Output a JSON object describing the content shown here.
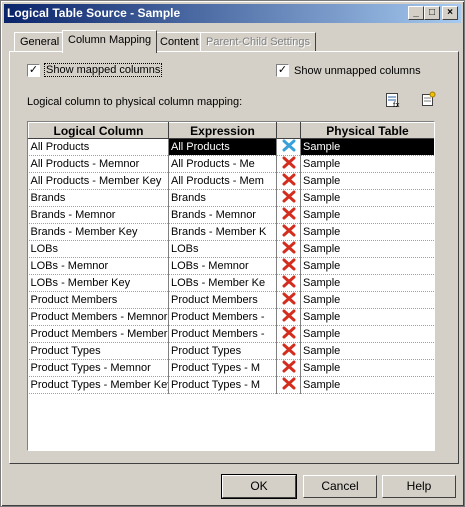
{
  "window": {
    "title": "Logical Table Source - Sample"
  },
  "titlebar_buttons": {
    "minimize": "_",
    "maximize": "□",
    "close": "×"
  },
  "tabs": [
    {
      "label": "General"
    },
    {
      "label": "Column Mapping"
    },
    {
      "label": "Content"
    },
    {
      "label": "Parent-Child Settings"
    }
  ],
  "options": {
    "show_mapped_label": "Show mapped columns",
    "show_mapped_checked": true,
    "show_unmapped_label": "Show unmapped columns",
    "show_unmapped_checked": true,
    "mapping_caption": "Logical column to physical column mapping:"
  },
  "grid": {
    "headers": {
      "logical": "Logical Column",
      "expression": "Expression",
      "physical": "Physical Table"
    },
    "rows": [
      {
        "logical": "All Products",
        "expression": "All Products",
        "physical": "Sample",
        "selected": true
      },
      {
        "logical": "All Products -  Memnor",
        "expression": "All Products  -  Me",
        "physical": "Sample"
      },
      {
        "logical": "All Products - Member Key",
        "expression": "All Products  - Mem",
        "physical": "Sample"
      },
      {
        "logical": "Brands",
        "expression": "Brands",
        "physical": "Sample"
      },
      {
        "logical": "Brands -  Memnor",
        "expression": "Brands -  Memnor",
        "physical": "Sample"
      },
      {
        "logical": "Brands - Member Key",
        "expression": "Brands - Member K",
        "physical": "Sample"
      },
      {
        "logical": "LOBs",
        "expression": "LOBs",
        "physical": "Sample"
      },
      {
        "logical": "LOBs -  Memnor",
        "expression": "LOBs -  Memnor",
        "physical": "Sample"
      },
      {
        "logical": "LOBs - Member Key",
        "expression": "LOBs - Member Ke",
        "physical": "Sample"
      },
      {
        "logical": "Product Members",
        "expression": "Product Members",
        "physical": "Sample"
      },
      {
        "logical": "Product Members -  Memnor",
        "expression": "Product Members -",
        "physical": "Sample"
      },
      {
        "logical": "Product Members - Member",
        "expression": "Product Members -",
        "physical": "Sample"
      },
      {
        "logical": "Product Types",
        "expression": "Product Types",
        "physical": "Sample"
      },
      {
        "logical": "Product Types -  Memnor",
        "expression": "Product Types  -  M",
        "physical": "Sample"
      },
      {
        "logical": "Product Types - Member Key",
        "expression": "Product Types - M",
        "physical": "Sample"
      }
    ]
  },
  "buttons": {
    "ok": "OK",
    "cancel": "Cancel",
    "help": "Help"
  },
  "colors": {
    "delete_icon": "#d22d1e",
    "delete_icon_selected": "#3aa0d8",
    "selection": "#000000"
  }
}
